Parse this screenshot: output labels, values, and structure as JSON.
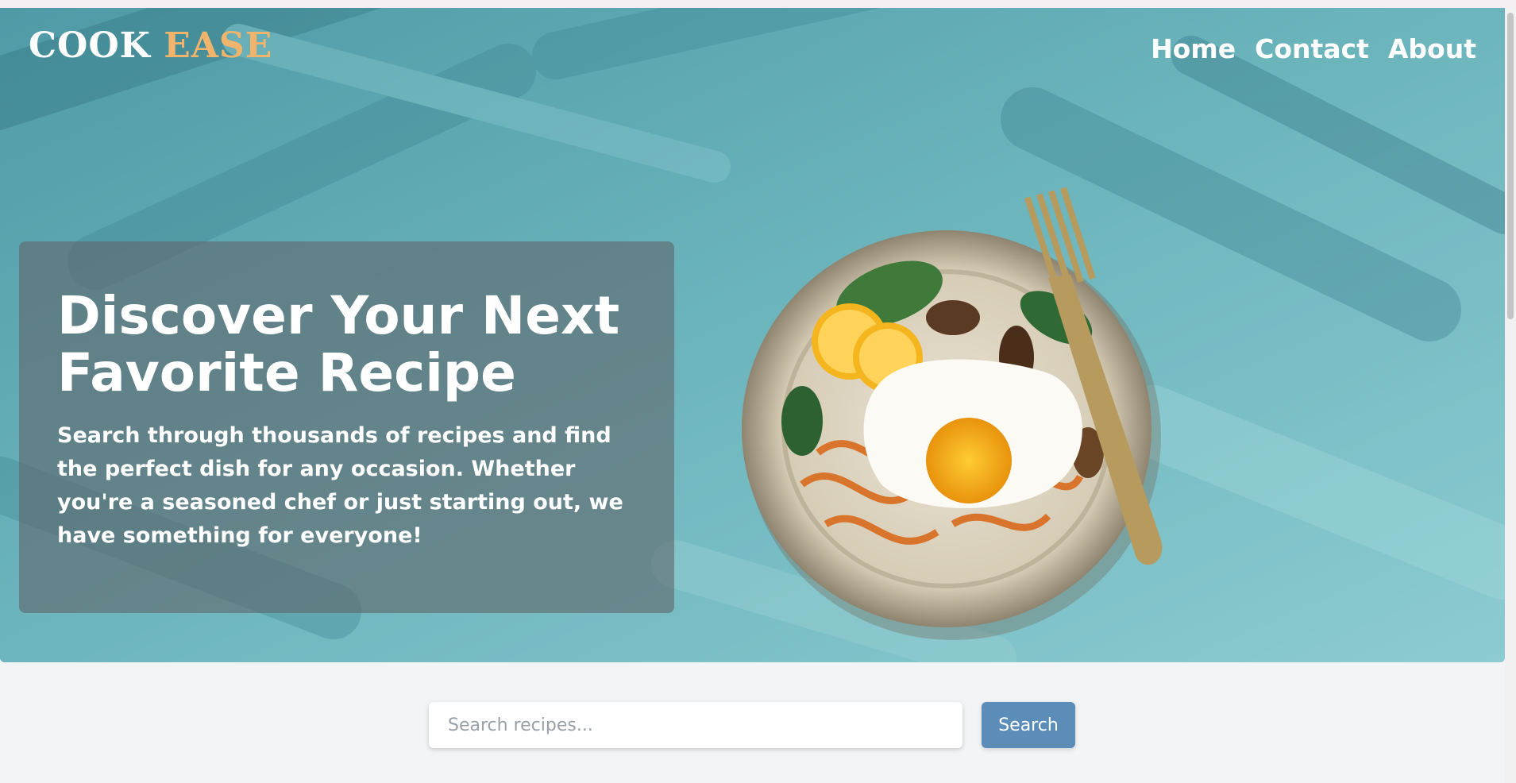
{
  "header": {
    "logo_main": "COOK",
    "logo_accent": "EASE",
    "nav": [
      {
        "label": "Home"
      },
      {
        "label": "Contact"
      },
      {
        "label": "About"
      }
    ]
  },
  "hero": {
    "title": "Discover Your Next Favorite Recipe",
    "description": "Search through thousands of recipes and find the perfect dish for any occasion. Whether you're a seasoned chef or just starting out, we have something for everyone!",
    "image": "food-bowl-with-egg-and-fork"
  },
  "search": {
    "placeholder": "Search recipes...",
    "value": "",
    "button_label": "Search"
  },
  "colors": {
    "brand_accent": "#f0b46c",
    "button": "#5b8db8",
    "hero_bg": "#5fa9b3"
  }
}
